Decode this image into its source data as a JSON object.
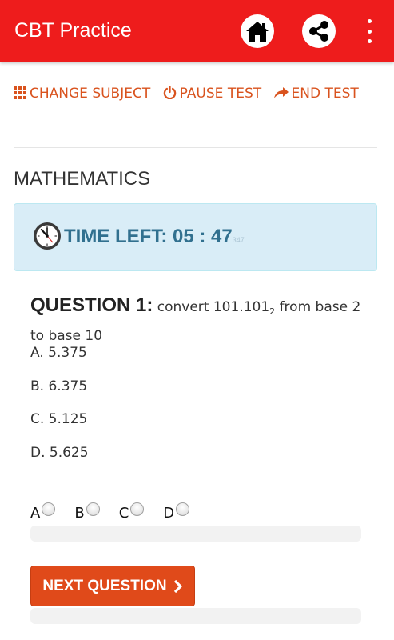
{
  "appbar": {
    "title": "CBT Practice",
    "home_icon": "home-icon",
    "share_icon": "share-icon",
    "more_icon": "more-vert-icon",
    "background": "#ee1c1c"
  },
  "toolbar": {
    "change_subject_label": "CHANGE SUBJECT",
    "pause_test_label": "PAUSE TEST",
    "end_test_label": "END TEST",
    "link_color": "#d9531e"
  },
  "subject": {
    "name": "MATHEMATICS"
  },
  "timer": {
    "label": "TIME LEFT: 05 : 47",
    "seconds_remaining": "347",
    "icon": "clock-icon"
  },
  "question": {
    "label": "QUESTION 1:",
    "text_before_sub": "convert 101.101",
    "subscript": "2",
    "text_after_sub": " from base 2 to base 10",
    "options": [
      "A. 5.375",
      "B. 6.375",
      "C. 5.125",
      "D. 5.625"
    ]
  },
  "answers": [
    "A",
    "B",
    "C",
    "D"
  ],
  "next_button": {
    "label": "NEXT QUESTION",
    "icon": "chevron-right-icon",
    "color": "#e04a1a"
  }
}
